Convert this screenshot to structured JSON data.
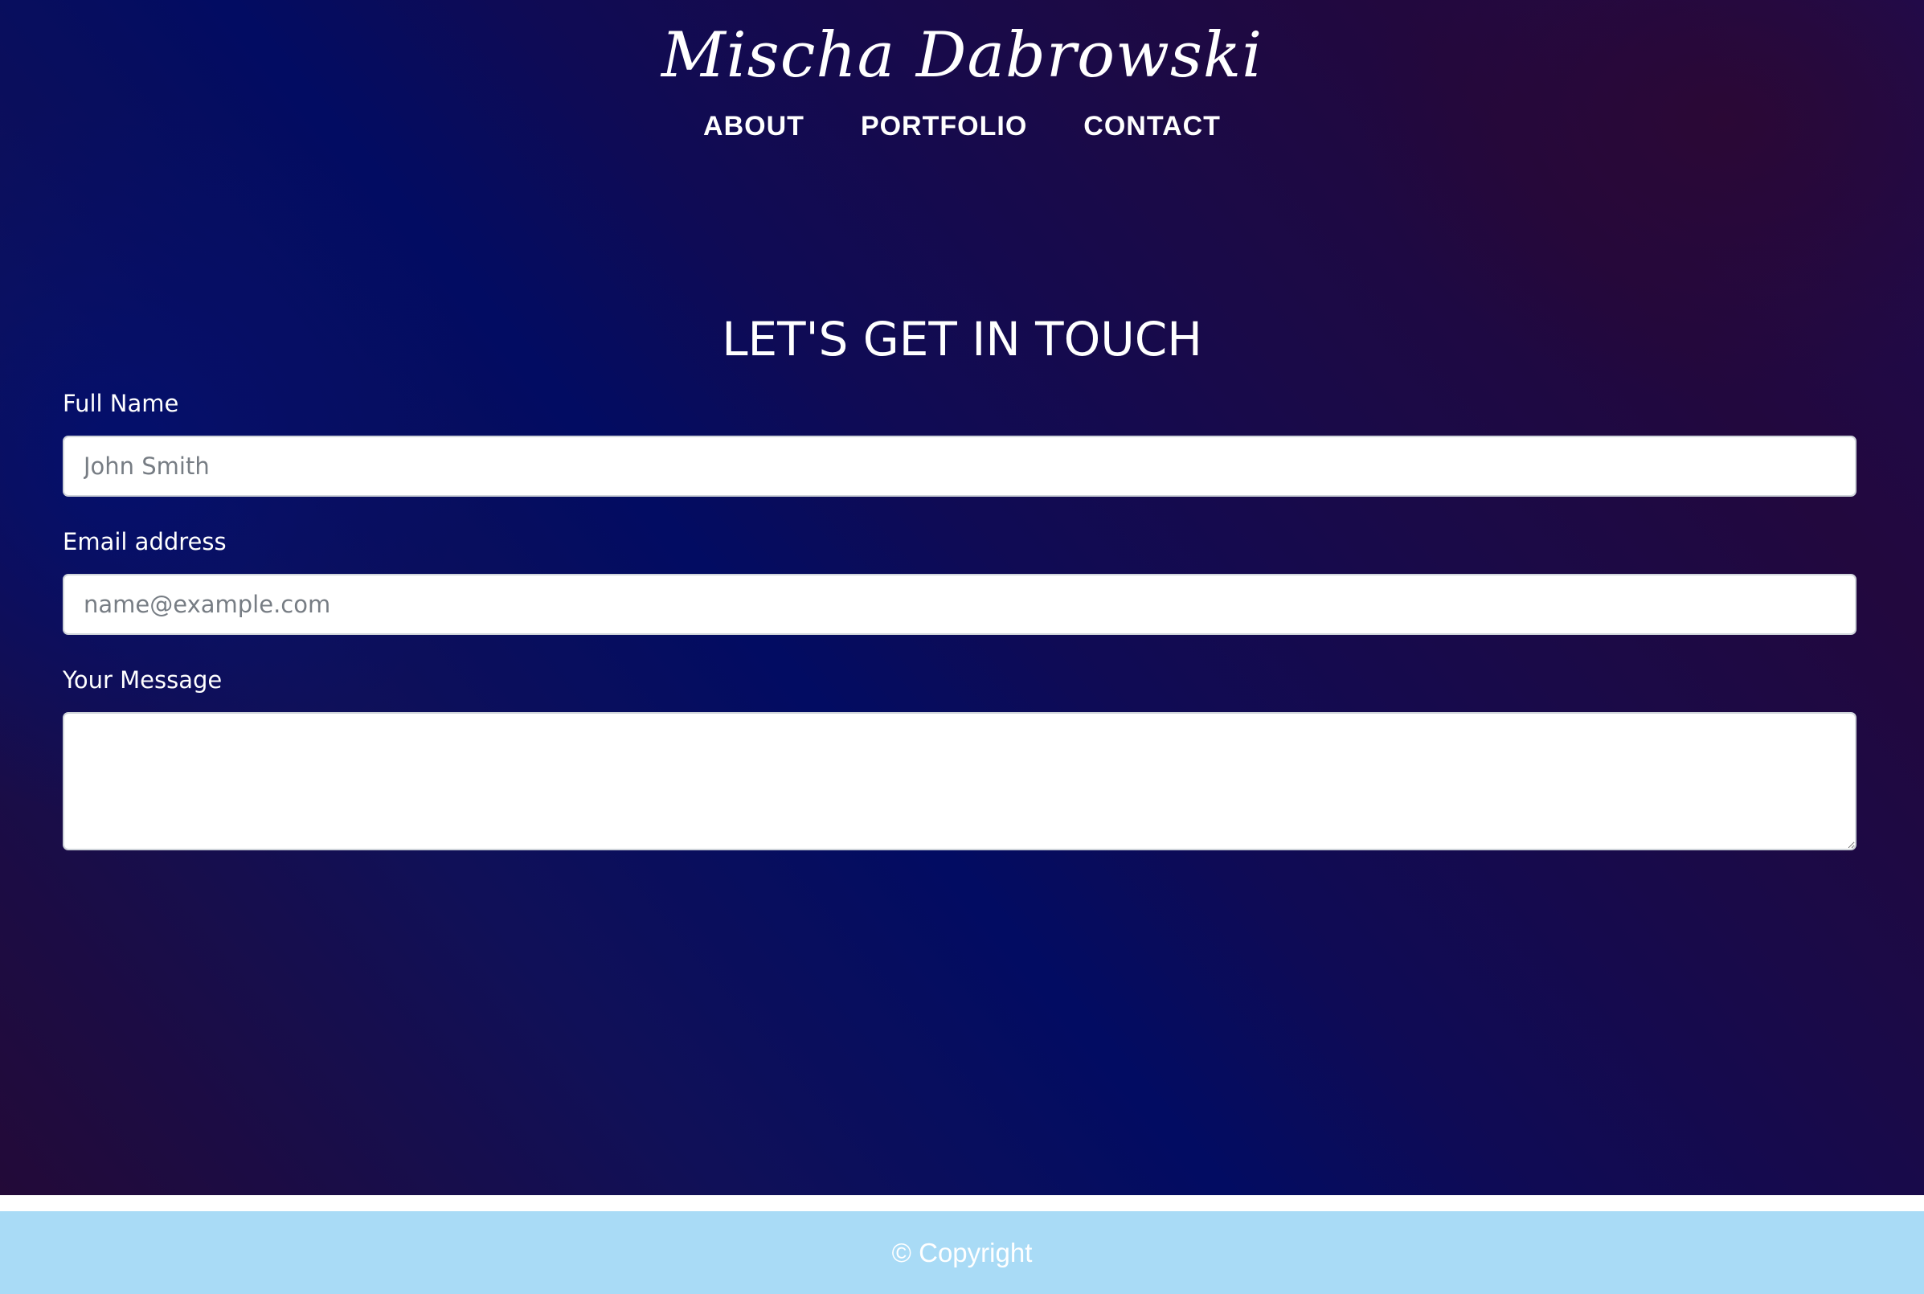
{
  "header": {
    "site_name": "Mischa Dabrowski",
    "nav": [
      {
        "label": "ABOUT"
      },
      {
        "label": "PORTFOLIO"
      },
      {
        "label": "CONTACT"
      }
    ]
  },
  "contact": {
    "title": "LET'S GET IN TOUCH",
    "full_name": {
      "label": "Full Name",
      "placeholder": "John Smith",
      "value": ""
    },
    "email": {
      "label": "Email address",
      "placeholder": "name@example.com",
      "value": ""
    },
    "message": {
      "label": "Your Message",
      "placeholder": "",
      "value": ""
    }
  },
  "footer": {
    "text": "© Copyright"
  },
  "colors": {
    "footer_bg": "#a9dbf6",
    "hero_dark_blue": "#020c62",
    "hero_purple": "#22083e"
  }
}
